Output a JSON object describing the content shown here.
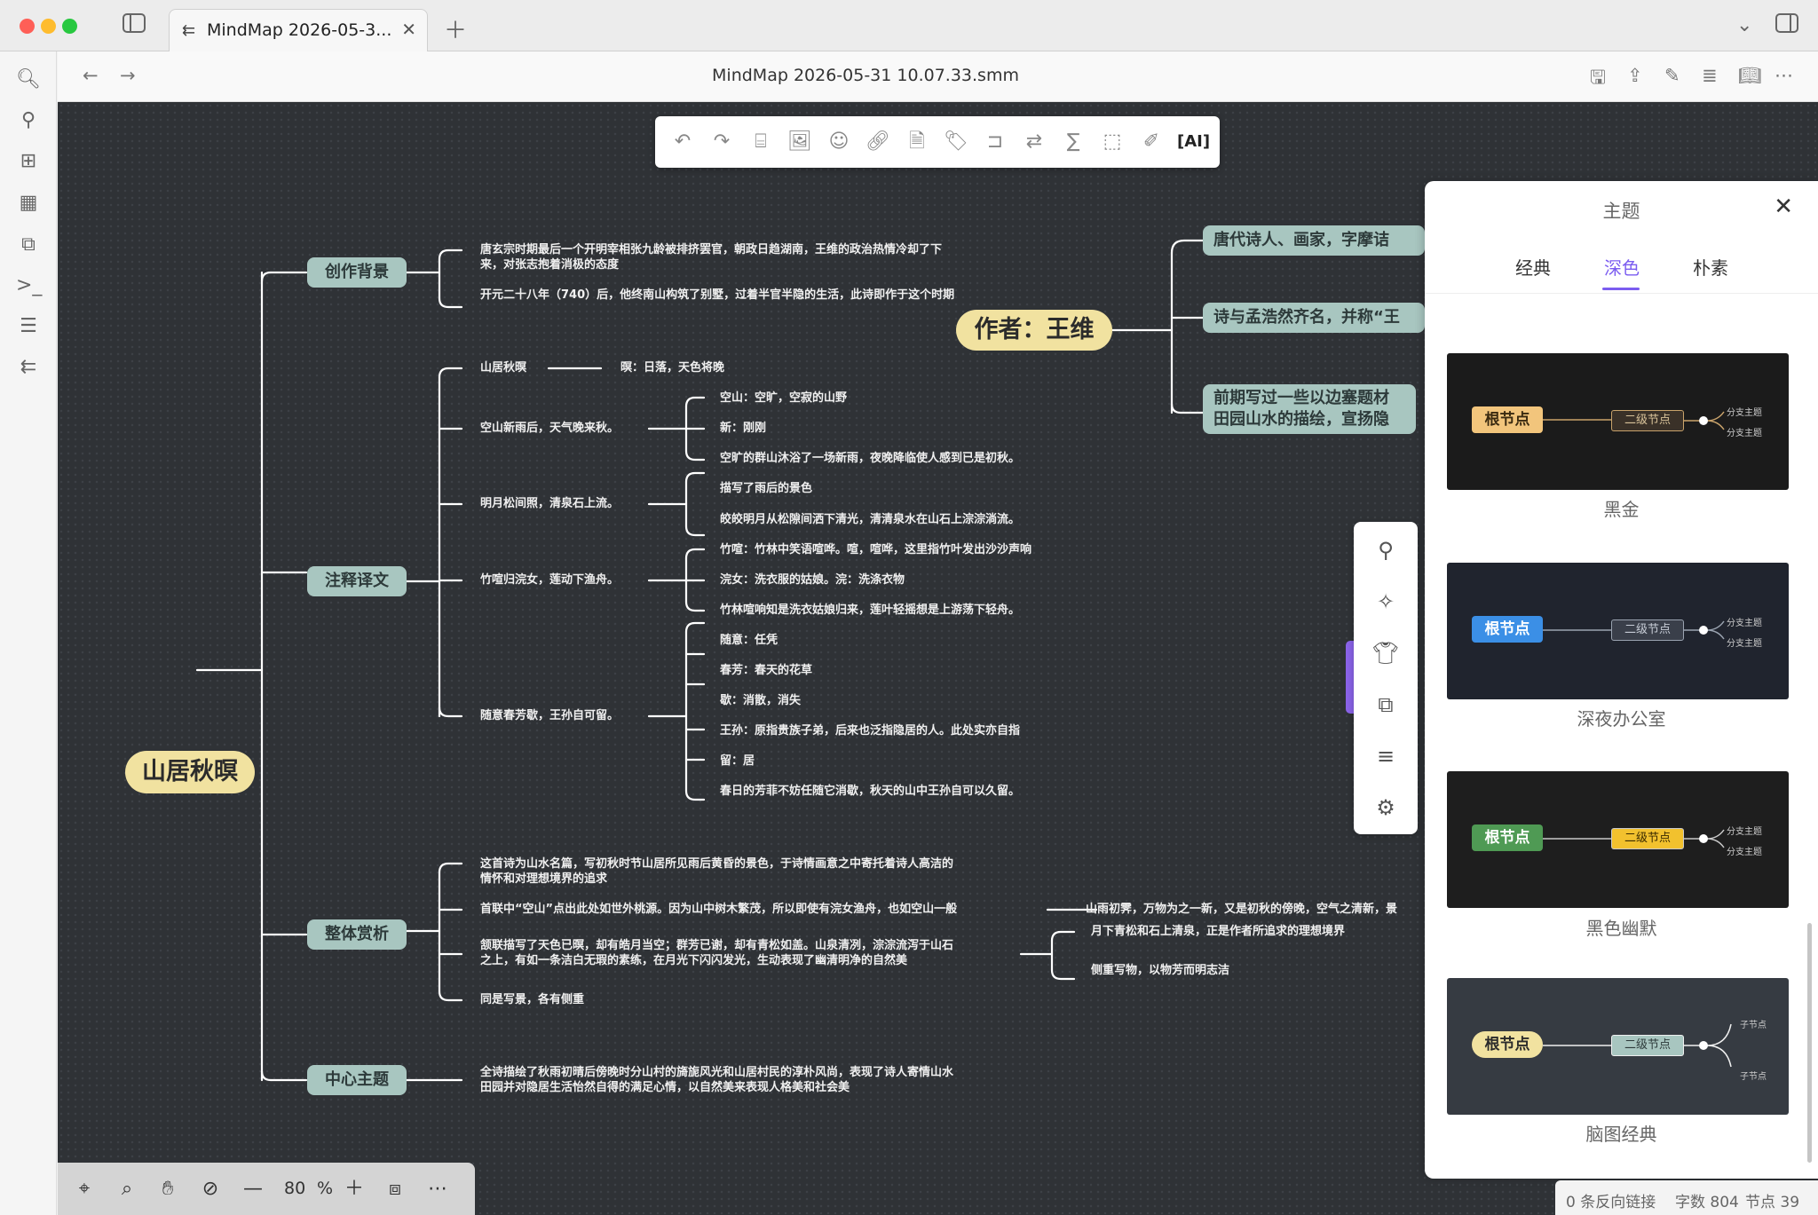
{
  "window": {
    "tab_title": "MindMap 2026-05-3...",
    "doc_title": "MindMap 2026-05-31 10.07.33.smm"
  },
  "map": {
    "root": "山居秋暝",
    "author_node": "作者：王维",
    "author_children": [
      "唐代诗人、画家，字摩诘",
      "诗与孟浩然齐名，并称“王",
      "前期写过一些以边塞题材\n田园山水的描绘，宣扬隐"
    ],
    "branches": [
      {
        "label": "创作背景",
        "items": [
          "唐玄宗时期最后一个开明宰相张九龄被排挤罢官，朝政日趋湖南，王维的政治热情冷却了下\n来，对张志抱着消极的态度",
          "开元二十八年（740）后，他终南山构筑了别墅，过着半官半隐的生活，此诗即作于这个时期"
        ]
      },
      {
        "label": "注释译文",
        "items": [
          {
            "text": "山居秋暝",
            "children": [
              "暝：日落，天色将晚"
            ]
          },
          {
            "text": "空山新雨后，天气晚来秋。",
            "children": [
              "空山：空旷，空寂的山野",
              "新：刚刚",
              "空旷的群山沐浴了一场新雨，夜晚降临使人感到已是初秋。"
            ]
          },
          {
            "text": "明月松间照，清泉石上流。",
            "children": [
              "描写了雨后的景色",
              "皎皎明月从松隙间洒下清光，清清泉水在山石上淙淙淌流。"
            ]
          },
          {
            "text": "竹喧归浣女，莲动下渔舟。",
            "children": [
              "竹喧：竹林中笑语喧哗。喧，喧哗，这里指竹叶发出沙沙声响",
              "浣女：洗衣服的姑娘。浣：洗涤衣物",
              "竹林喧响知是洗衣姑娘归来，莲叶轻摇想是上游荡下轻舟。"
            ]
          },
          {
            "text": "随意春芳歇，王孙自可留。",
            "children": [
              "随意：任凭",
              "春芳：春天的花草",
              "歇：消散，消失",
              "王孙：原指贵族子弟，后来也泛指隐居的人。此处实亦自指",
              "留：居",
              "春日的芳菲不妨任随它消歇，秋天的山中王孙自可以久留。"
            ]
          }
        ]
      },
      {
        "label": "整体赏析",
        "items": [
          {
            "text": "这首诗为山水名篇，写初秋时节山居所见雨后黄昏的景色，于诗情画意之中寄托着诗人高洁的\n情怀和对理想境界的追求",
            "children": []
          },
          {
            "text": "首联中“空山”点出此处如世外桃源。因为山中树木繁茂，所以即使有浣女渔舟，也如空山一般",
            "children": [
              "山雨初霁，万物为之一新，又是初秋的傍晚，空气之清新，景"
            ]
          },
          {
            "text": "颔联描写了天色已暝，却有皓月当空；群芳已谢，却有青松如盖。山泉清冽，淙淙流泻于山石\n之上，有如一条洁白无瑕的素练，在月光下闪闪发光，生动表现了幽清明净的自然美",
            "children": [
              "月下青松和石上清泉，正是作者所追求的理想境界",
              "侧重写物，以物芳而明志洁"
            ]
          },
          {
            "text": "同是写景，各有侧重",
            "children": []
          }
        ]
      },
      {
        "label": "中心主题",
        "items": [
          "全诗描绘了秋雨初晴后傍晚时分山村的旖旎风光和山居村民的淳朴风尚，表现了诗人寄情山水\n田园并对隐居生活怡然自得的满足心情，以自然美来表现人格美和社会美"
        ]
      }
    ]
  },
  "panel": {
    "title": "主题",
    "tabs": [
      "经典",
      "深色",
      "朴素"
    ],
    "active_tab": "深色",
    "themes": [
      {
        "name": "黑金",
        "root": "根节点",
        "second": "二级节点",
        "branch": "分支主题",
        "bg": "#1b1b1b",
        "root_bg": "#f2c57c",
        "root_fg": "#3a2a10",
        "second_bg": "#3a3128",
        "second_fg": "#d9c39a",
        "line": "#c9a36b"
      },
      {
        "name": "深夜办公室",
        "root": "根节点",
        "second": "二级节点",
        "branch": "分支主题",
        "bg": "#20242e",
        "root_bg": "#3b8fe6",
        "root_fg": "#ffffff",
        "second_bg": "#3a3f4a",
        "second_fg": "#c7ccd6",
        "line": "#9aa3b0"
      },
      {
        "name": "黑色幽默",
        "root": "根节点",
        "second": "二级节点",
        "branch": "分支主题",
        "bg": "#1e1e1e",
        "root_bg": "#4f9a54",
        "root_fg": "#ffffff",
        "second_bg": "#f2c12e",
        "second_fg": "#3a2a00",
        "line": "#c9c9c9"
      },
      {
        "name": "脑图经典",
        "root": "根节点",
        "second": "二级节点",
        "branch": "子节点",
        "bg": "#363b42",
        "root_bg": "#f1e2a0",
        "root_fg": "#2b2b2b",
        "second_bg": "#a8c6c0",
        "second_fg": "#2d3a3a",
        "line": "#f0f0f0"
      }
    ]
  },
  "zoom": {
    "value": "80",
    "unit": "%"
  },
  "status": {
    "backlinks": "0 条反向链接",
    "words": "字数 804",
    "nodes": "节点 39"
  },
  "colors": {
    "canvas_bg": "#2f3236",
    "root_node": "#f1e2a0",
    "branch_node": "#a8c6c0",
    "line": "#ffffff",
    "accent": "#7b5cf0"
  }
}
